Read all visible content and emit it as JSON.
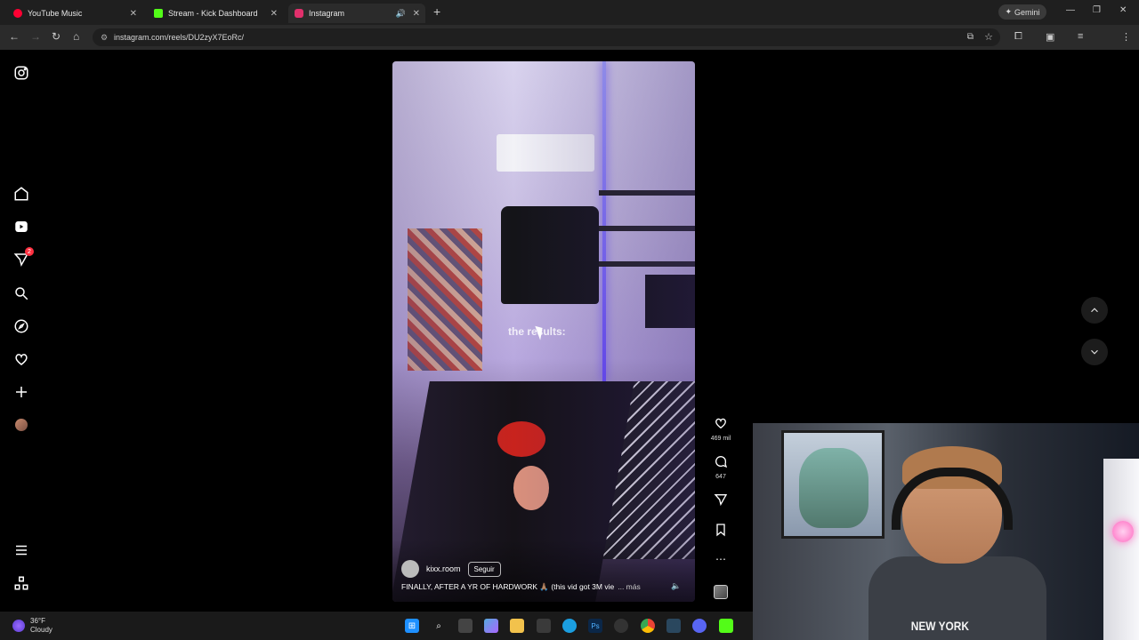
{
  "browser": {
    "tabs": [
      {
        "label": "YouTube Music",
        "color": "#ff0033"
      },
      {
        "label": "Stream - Kick Dashboard",
        "color": "#53fc18"
      },
      {
        "label": "Instagram",
        "color": "#e1306c"
      }
    ],
    "gemini_label": "Gemini",
    "url": "instagram.com/reels/DU2zyX7EoRc/"
  },
  "sidebar": {
    "items": [
      {
        "name": "instagram-logo-icon"
      },
      {
        "name": "home-icon"
      },
      {
        "name": "reels-icon"
      },
      {
        "name": "messages-icon",
        "badge": "2"
      },
      {
        "name": "search-icon"
      },
      {
        "name": "explore-icon"
      },
      {
        "name": "notifications-icon"
      },
      {
        "name": "create-icon"
      },
      {
        "name": "profile-avatar"
      },
      {
        "name": "menu-icon"
      },
      {
        "name": "also-from-meta-icon"
      }
    ]
  },
  "reel": {
    "overlay_text": "the results:",
    "author": "kixx.room",
    "follow_label": "Seguir",
    "caption": "FINALLY, AFTER A YR OF HARDWORK 🙏🏽 (this vid got 3M vie",
    "more_label": "... más"
  },
  "actions": {
    "likes": "469 mil",
    "comments": "647"
  },
  "webcam": {
    "shirt_text": "NEW YORK"
  },
  "taskbar": {
    "temperature": "36°F",
    "condition": "Cloudy"
  }
}
